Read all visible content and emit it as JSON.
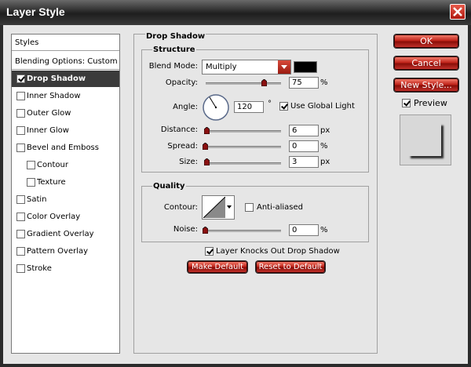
{
  "window": {
    "title": "Layer Style"
  },
  "left_panel": {
    "items": [
      {
        "label": "Styles"
      },
      {
        "label": "Blending Options: Custom"
      },
      {
        "label": "Drop Shadow",
        "checked": true,
        "selected": true
      },
      {
        "label": "Inner Shadow",
        "checked": false
      },
      {
        "label": "Outer Glow",
        "checked": false
      },
      {
        "label": "Inner Glow",
        "checked": false
      },
      {
        "label": "Bevel and Emboss",
        "checked": false
      },
      {
        "label": "Contour",
        "checked": false
      },
      {
        "label": "Texture",
        "checked": false
      },
      {
        "label": "Satin",
        "checked": false
      },
      {
        "label": "Color Overlay",
        "checked": false
      },
      {
        "label": "Gradient Overlay",
        "checked": false
      },
      {
        "label": "Pattern Overlay",
        "checked": false
      },
      {
        "label": "Stroke",
        "checked": false
      }
    ]
  },
  "drop_shadow": {
    "title": "Drop Shadow",
    "structure": {
      "title": "Structure",
      "blend_mode_label": "Blend Mode:",
      "blend_mode_value": "Multiply",
      "shadow_color": "#000000",
      "opacity_label": "Opacity:",
      "opacity_value": "75",
      "opacity_unit": "%",
      "opacity_fraction": 0.75,
      "angle_label": "Angle:",
      "angle_value": "120",
      "angle_unit": "°",
      "use_global_light_label": "Use Global Light",
      "use_global_light_checked": true,
      "distance_label": "Distance:",
      "distance_value": "6",
      "distance_unit": "px",
      "distance_fraction": 0.02,
      "spread_label": "Spread:",
      "spread_value": "0",
      "spread_unit": "%",
      "spread_fraction": 0,
      "size_label": "Size:",
      "size_value": "3",
      "size_unit": "px",
      "size_fraction": 0.02
    },
    "quality": {
      "title": "Quality",
      "contour_label": "Contour:",
      "anti_aliased_label": "Anti-aliased",
      "anti_aliased_checked": false,
      "noise_label": "Noise:",
      "noise_value": "0",
      "noise_unit": "%",
      "noise_fraction": 0
    },
    "knockout_label": "Layer Knocks Out Drop Shadow",
    "knockout_checked": true,
    "make_default_label": "Make Default",
    "reset_default_label": "Reset to Default"
  },
  "right_panel": {
    "ok_label": "OK",
    "cancel_label": "Cancel",
    "new_style_label": "New Style...",
    "preview_label": "Preview",
    "preview_checked": true
  },
  "colors": {
    "accent_red": "#c0241a",
    "selected_bg": "#3b3b3b",
    "dialog_bg": "#e6e6e6"
  }
}
